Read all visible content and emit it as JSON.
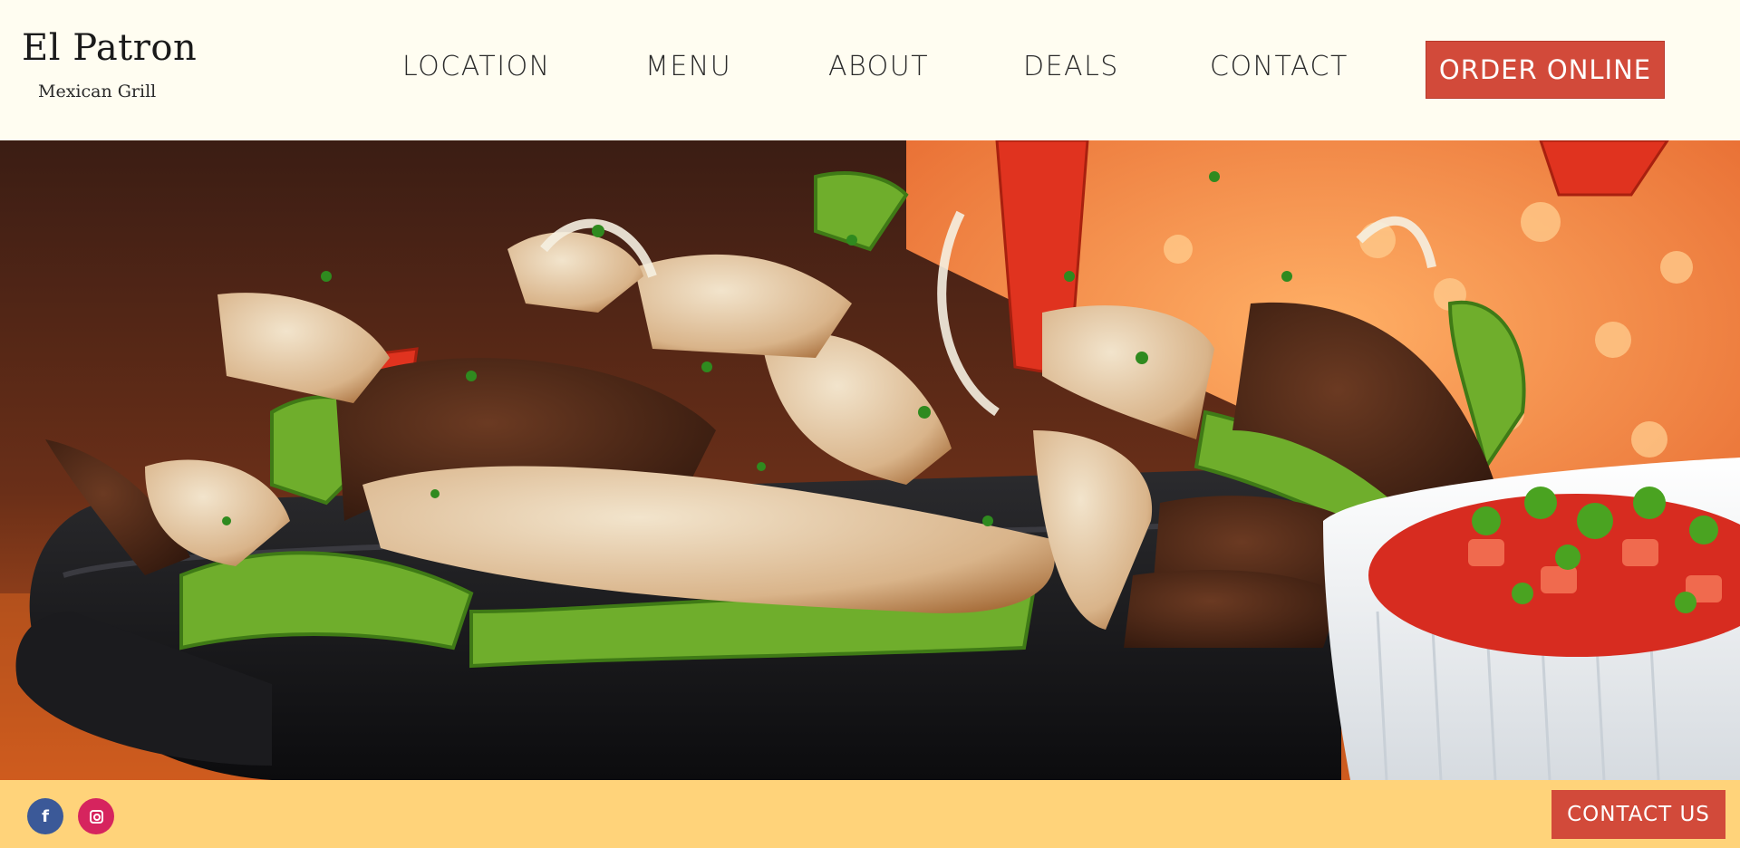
{
  "brand": {
    "name": "El Patron",
    "tagline": "Mexican Grill"
  },
  "nav": {
    "items": [
      {
        "label": "LOCATION"
      },
      {
        "label": "MENU"
      },
      {
        "label": "ABOUT"
      },
      {
        "label": "DEALS"
      },
      {
        "label": "CONTACT"
      }
    ],
    "order_label": "ORDER ONLINE"
  },
  "hero": {
    "image_subject": "fajitas-skillet-photo"
  },
  "footer": {
    "social": [
      {
        "name": "facebook",
        "glyph": "f"
      },
      {
        "name": "instagram",
        "glyph": ""
      }
    ],
    "contact_label": "CONTACT US"
  },
  "colors": {
    "background": "#fffdf1",
    "accent": "#d24a3a",
    "footer": "#ffd37a",
    "facebook": "#3b5998",
    "instagram": "#d6245e"
  }
}
